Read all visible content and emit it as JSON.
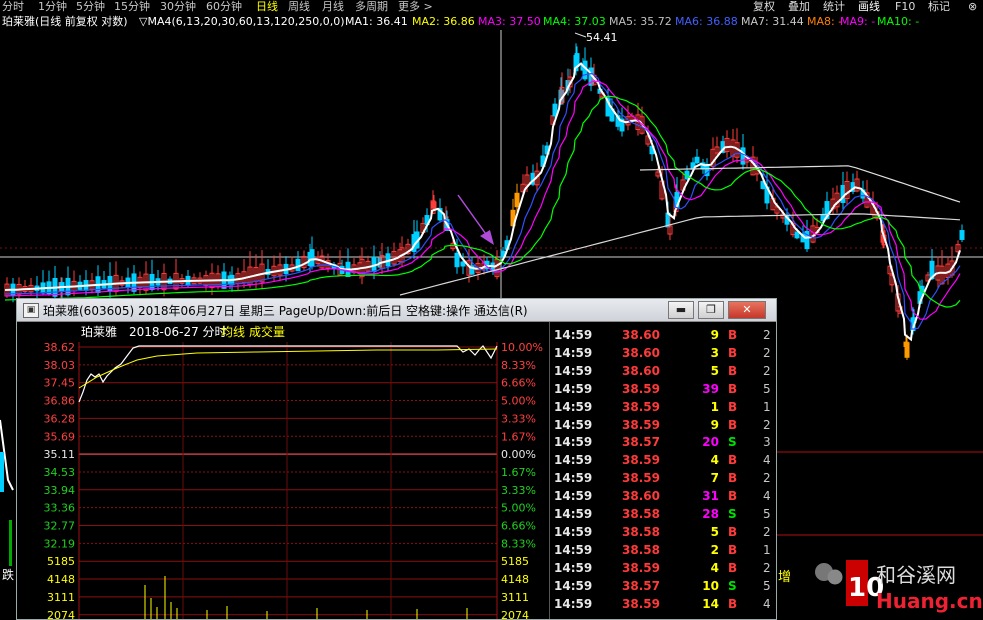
{
  "toolbar": {
    "periods": [
      "分时",
      "1分钟",
      "5分钟",
      "15分钟",
      "30分钟",
      "60分钟",
      "日线",
      "周线",
      "月线",
      "多周期",
      "更多 >"
    ],
    "active": "日线",
    "right_buttons": [
      "复权",
      "叠加",
      "统计",
      "画线",
      "F10",
      "标记"
    ]
  },
  "ma_legend": {
    "stock": "珀莱雅(日线 前复权 对数)",
    "ma_param": "▽MA4(6,13,20,30,60,13,120,250,0,0)",
    "items": [
      {
        "label": "MA1: 36.41",
        "color": "#ffffff"
      },
      {
        "label": "MA2: 36.86",
        "color": "#ffff00"
      },
      {
        "label": "MA3: 37.50",
        "color": "#ff00ff"
      },
      {
        "label": "MA4: 37.03",
        "color": "#00ff00"
      },
      {
        "label": "MA5: 35.72",
        "color": "#c0c0c0"
      },
      {
        "label": "MA6: 36.88",
        "color": "#4060ff"
      },
      {
        "label": "MA7: 31.44",
        "color": "#c8c8c8"
      },
      {
        "label": "MA8: -",
        "color": "#ff8000"
      },
      {
        "label": "MA9: -",
        "color": "#ff00ff"
      },
      {
        "label": "MA10: -",
        "color": "#00ff00"
      }
    ],
    "peak_label": "54.41"
  },
  "kline_colors": {
    "up": "#ff3c3c",
    "down": "#00d0ff",
    "ma_white": "#ffffff",
    "ma_yellow": "#ffff00",
    "ma_magenta": "#ff00ff",
    "ma_green": "#00ff00",
    "ma_blue": "#3050ff",
    "ma_long": "#d8d8d8",
    "highlight": "#ff9900"
  },
  "popup": {
    "title": "珀莱雅(603605) 2018年06月27日 星期三 PageUp/Down:前后日 空格键:操作 通达信(R)",
    "header": {
      "name": "珀莱雅",
      "date": "2018-06-27 分时",
      "avg": "均线",
      "vol": "成交量"
    },
    "prices": [
      "38.62",
      "38.03",
      "37.45",
      "36.86",
      "36.28",
      "35.69",
      "35.11",
      "34.53",
      "33.94",
      "33.36",
      "32.77",
      "32.19"
    ],
    "percents": [
      "10.00%",
      "8.33%",
      "6.66%",
      "5.00%",
      "3.33%",
      "1.67%",
      "0.00%",
      "1.67%",
      "3.33%",
      "5.00%",
      "6.66%",
      "8.33%"
    ],
    "vol_labels": [
      "5185",
      "4148",
      "3111",
      "2074"
    ],
    "ticks": [
      {
        "time": "14:59",
        "price": "38.60",
        "vol": "9",
        "dir": "B",
        "n": "2"
      },
      {
        "time": "14:59",
        "price": "38.60",
        "vol": "3",
        "dir": "B",
        "n": "2"
      },
      {
        "time": "14:59",
        "price": "38.60",
        "vol": "5",
        "dir": "B",
        "n": "2"
      },
      {
        "time": "14:59",
        "price": "38.59",
        "vol": "39",
        "dir": "B",
        "n": "5"
      },
      {
        "time": "14:59",
        "price": "38.59",
        "vol": "1",
        "dir": "B",
        "n": "1"
      },
      {
        "time": "14:59",
        "price": "38.59",
        "vol": "9",
        "dir": "B",
        "n": "2"
      },
      {
        "time": "14:59",
        "price": "38.57",
        "vol": "20",
        "dir": "S",
        "n": "3"
      },
      {
        "time": "14:59",
        "price": "38.59",
        "vol": "4",
        "dir": "B",
        "n": "4"
      },
      {
        "time": "14:59",
        "price": "38.59",
        "vol": "7",
        "dir": "B",
        "n": "2"
      },
      {
        "time": "14:59",
        "price": "38.60",
        "vol": "31",
        "dir": "B",
        "n": "4"
      },
      {
        "time": "14:59",
        "price": "38.58",
        "vol": "28",
        "dir": "S",
        "n": "5"
      },
      {
        "time": "14:59",
        "price": "38.58",
        "vol": "5",
        "dir": "B",
        "n": "2"
      },
      {
        "time": "14:59",
        "price": "38.58",
        "vol": "2",
        "dir": "B",
        "n": "1"
      },
      {
        "time": "14:59",
        "price": "38.59",
        "vol": "4",
        "dir": "B",
        "n": "2"
      },
      {
        "time": "14:59",
        "price": "38.57",
        "vol": "10",
        "dir": "S",
        "n": "5"
      },
      {
        "time": "14:59",
        "price": "38.59",
        "vol": "14",
        "dir": "B",
        "n": "4"
      }
    ]
  },
  "side": {
    "zeng": "增",
    "left_glyph": "跌"
  },
  "watermark": {
    "brand": "和谷溪网",
    "domain": "Huang.cn",
    "num": "10"
  }
}
